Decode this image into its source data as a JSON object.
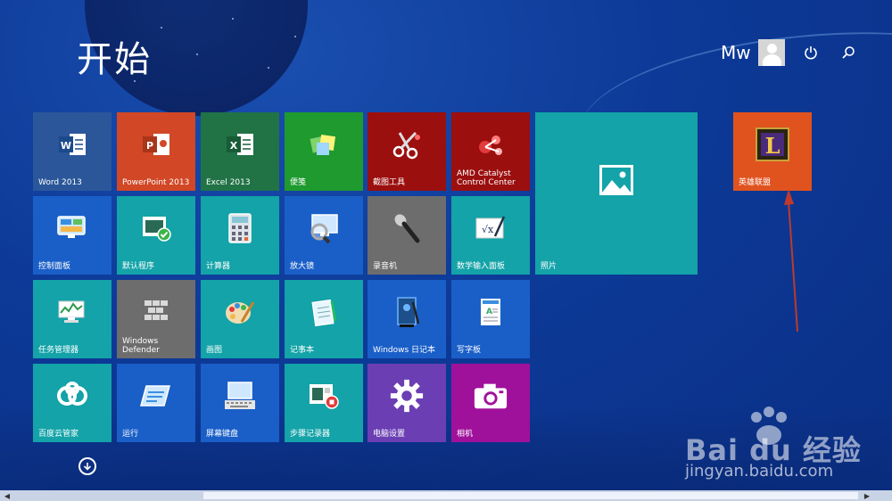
{
  "header": {
    "title": "开始",
    "user_name": "Mw"
  },
  "tiles": [
    {
      "id": "word",
      "label": "Word 2013",
      "color": "#2b579a",
      "icon": "word-icon"
    },
    {
      "id": "powerpoint",
      "label": "PowerPoint 2013",
      "color": "#d24726",
      "icon": "powerpoint-icon"
    },
    {
      "id": "excel",
      "label": "Excel 2013",
      "color": "#217346",
      "icon": "excel-icon"
    },
    {
      "id": "sticky",
      "label": "便笺",
      "color": "#1e9a2f",
      "icon": "sticky-notes-icon"
    },
    {
      "id": "snipping",
      "label": "截图工具",
      "color": "#9b0f0f",
      "icon": "scissors-icon"
    },
    {
      "id": "amd",
      "label": "AMD Catalyst Control Center",
      "color": "#9b0f0f",
      "icon": "amd-icon"
    },
    {
      "id": "photos",
      "label": "照片",
      "color": "#13a3a8",
      "icon": "photo-icon"
    },
    {
      "id": "lol",
      "label": "英雄联盟",
      "color": "#e0531f",
      "icon": "league-of-legends-icon"
    },
    {
      "id": "control",
      "label": "控制面板",
      "color": "#1a5fc8",
      "icon": "control-panel-icon"
    },
    {
      "id": "default",
      "label": "默认程序",
      "color": "#13a3a8",
      "icon": "default-programs-icon"
    },
    {
      "id": "calc",
      "label": "计算器",
      "color": "#13a3a8",
      "icon": "calculator-icon"
    },
    {
      "id": "magnifier",
      "label": "放大镜",
      "color": "#1a5fc8",
      "icon": "magnifier-icon"
    },
    {
      "id": "recorder",
      "label": "录音机",
      "color": "#6d6d6d",
      "icon": "microphone-icon"
    },
    {
      "id": "math",
      "label": "数学输入面板",
      "color": "#13a3a8",
      "icon": "math-input-icon"
    },
    {
      "id": "taskmgr",
      "label": "任务管理器",
      "color": "#13a3a8",
      "icon": "task-manager-icon"
    },
    {
      "id": "defender",
      "label": "Windows Defender",
      "color": "#6d6d6d",
      "icon": "defender-icon"
    },
    {
      "id": "paint",
      "label": "画图",
      "color": "#13a3a8",
      "icon": "paint-icon"
    },
    {
      "id": "notepad",
      "label": "记事本",
      "color": "#13a3a8",
      "icon": "notepad-icon"
    },
    {
      "id": "journal",
      "label": "Windows 日记本",
      "color": "#1a5fc8",
      "icon": "journal-icon"
    },
    {
      "id": "wordpad",
      "label": "写字板",
      "color": "#1a5fc8",
      "icon": "wordpad-icon"
    },
    {
      "id": "baiduyun",
      "label": "百度云管家",
      "color": "#13a3a8",
      "icon": "cloud-icon"
    },
    {
      "id": "run",
      "label": "运行",
      "color": "#1a5fc8",
      "icon": "run-icon"
    },
    {
      "id": "osk",
      "label": "屏幕键盘",
      "color": "#1a5fc8",
      "icon": "keyboard-icon"
    },
    {
      "id": "steps",
      "label": "步骤记录器",
      "color": "#13a3a8",
      "icon": "steps-recorder-icon"
    },
    {
      "id": "settings",
      "label": "电脑设置",
      "color": "#6b3fb3",
      "icon": "gear-icon"
    },
    {
      "id": "camera",
      "label": "相机",
      "color": "#a0119b",
      "icon": "camera-icon"
    }
  ],
  "watermark": {
    "brand": "Bai du 经验",
    "url": "jingyan.baidu.com"
  },
  "colors": {
    "accent_arrow": "#c0392b"
  }
}
